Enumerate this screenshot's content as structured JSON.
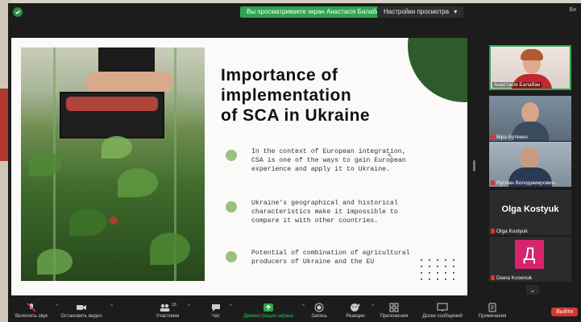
{
  "topbar": {
    "banner": "Вы просматриваете экран Анастасія Балабан",
    "settings": "Настройки просмотра",
    "caret": "▾",
    "right_text": "Ви"
  },
  "slide": {
    "title_lines": [
      "Importance of",
      "implementation",
      "of SCA in Ukraine"
    ],
    "bullets": [
      "In the context of European integration, CSA is one of the ways to gain European experience and apply it to Ukraine.",
      "Ukraine's geographical and historical characteristics make it impossible to compare it with other countries.",
      "Potential of combination of agricultural producers of Ukraine and the EU"
    ],
    "accent_color": "#2f5a2b",
    "bullet_color": "#9cc07f"
  },
  "participants": [
    {
      "name": "Анастасія Балабан"
    },
    {
      "name": "Віра Бутенко"
    },
    {
      "name": "Руслан Володимирович..."
    },
    {
      "name": "Olga Kostyuk",
      "big_name": "Olga Kostyuk"
    },
    {
      "name": "Diana Kosenuk",
      "avatar_letter": "Д"
    }
  ],
  "toolbar": {
    "items": [
      {
        "label": "Включить звук",
        "icon": "mic-muted-icon"
      },
      {
        "label": "Остановить видео",
        "icon": "video-icon"
      },
      {
        "label": "Участники",
        "icon": "participants-icon",
        "count": "18"
      },
      {
        "label": "Чат",
        "icon": "chat-icon"
      },
      {
        "label": "Демонстрация экрана",
        "icon": "share-screen-icon"
      },
      {
        "label": "Запись",
        "icon": "record-icon"
      },
      {
        "label": "Реакции",
        "icon": "reactions-icon"
      },
      {
        "label": "Приложения",
        "icon": "apps-icon"
      },
      {
        "label": "Доски сообщений",
        "icon": "whiteboard-icon"
      },
      {
        "label": "Примечания",
        "icon": "notes-icon"
      }
    ],
    "leave": "Выйти",
    "caret": "^"
  }
}
